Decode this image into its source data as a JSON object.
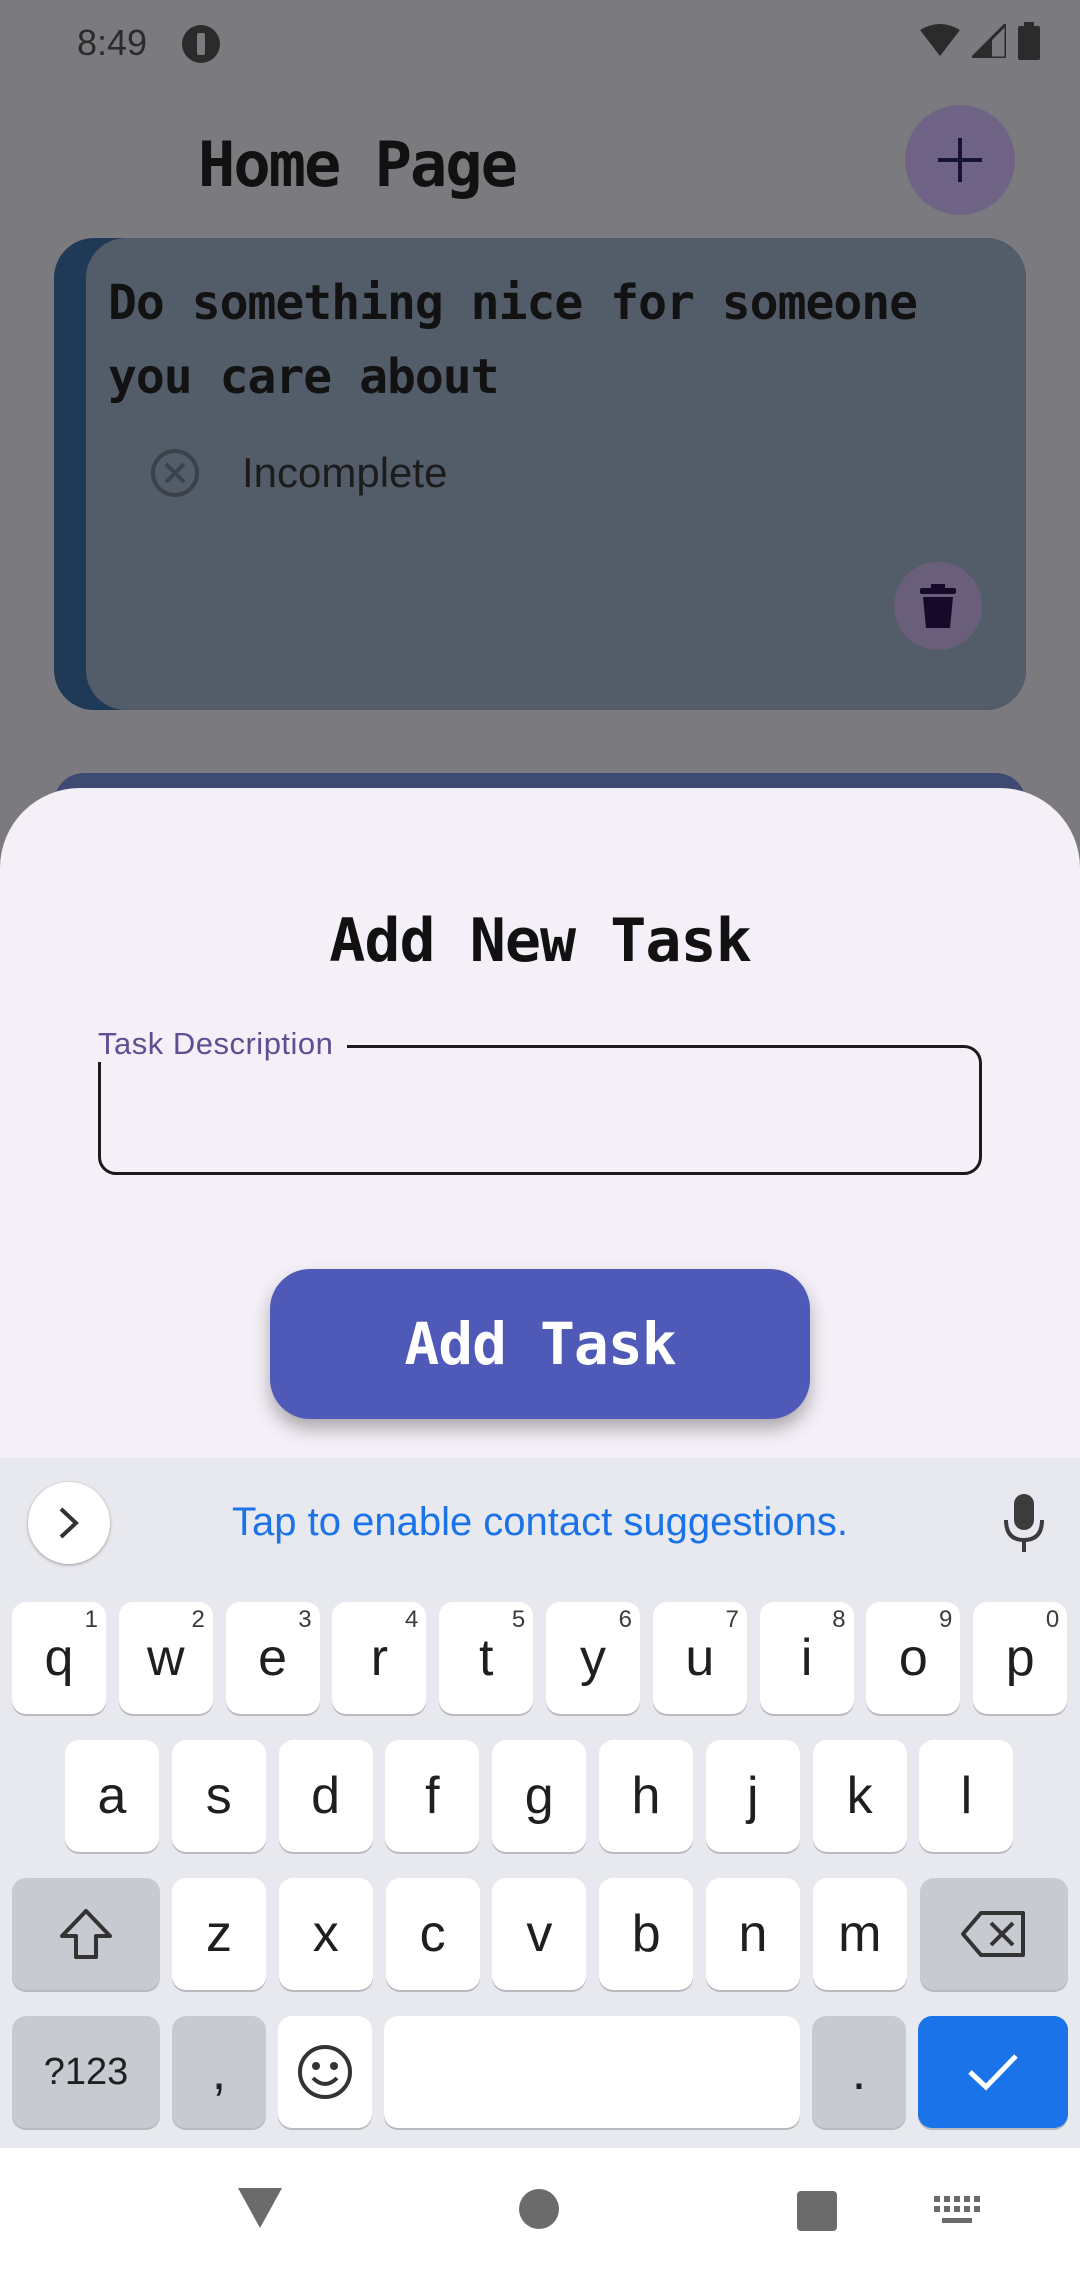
{
  "status_bar": {
    "time": "8:49"
  },
  "header": {
    "title": "Home Page"
  },
  "task": {
    "description": "Do something nice for someone you care about",
    "status": "Incomplete"
  },
  "sheet": {
    "title": "Add New Task",
    "field_label": "Task Description",
    "field_value": "",
    "button_label": "Add Task"
  },
  "keyboard": {
    "suggestion": "Tap to enable contact suggestions.",
    "row1": [
      {
        "k": "q",
        "h": "1"
      },
      {
        "k": "w",
        "h": "2"
      },
      {
        "k": "e",
        "h": "3"
      },
      {
        "k": "r",
        "h": "4"
      },
      {
        "k": "t",
        "h": "5"
      },
      {
        "k": "y",
        "h": "6"
      },
      {
        "k": "u",
        "h": "7"
      },
      {
        "k": "i",
        "h": "8"
      },
      {
        "k": "o",
        "h": "9"
      },
      {
        "k": "p",
        "h": "0"
      }
    ],
    "row2": [
      "a",
      "s",
      "d",
      "f",
      "g",
      "h",
      "j",
      "k",
      "l"
    ],
    "row3": [
      "z",
      "x",
      "c",
      "v",
      "b",
      "n",
      "m"
    ],
    "symbols_label": "?123",
    "comma": ",",
    "period": "."
  },
  "colors": {
    "accent": "#4e59b8",
    "keyboard_blue": "#1a73e8",
    "sheet_bg": "#f5f0f8"
  }
}
